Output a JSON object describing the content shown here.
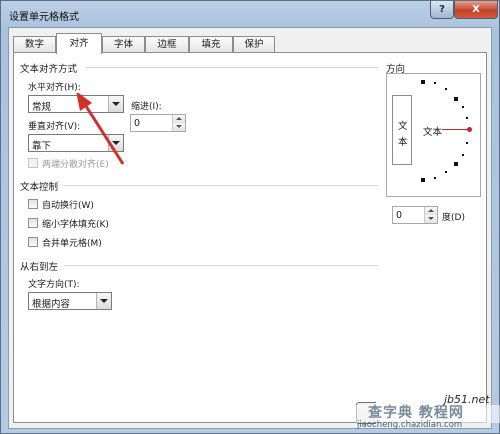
{
  "window": {
    "title": "设置单元格格式",
    "help_label": "?",
    "close_label": "X"
  },
  "tabs": [
    {
      "label": "数字",
      "active": false
    },
    {
      "label": "对齐",
      "active": true
    },
    {
      "label": "字体",
      "active": false
    },
    {
      "label": "边框",
      "active": false
    },
    {
      "label": "填充",
      "active": false
    },
    {
      "label": "保护",
      "active": false
    }
  ],
  "alignment": {
    "section_title": "文本对齐方式",
    "horizontal_label": "水平对齐(H):",
    "horizontal_value": "常规",
    "indent_label": "缩进(I):",
    "indent_value": "0",
    "vertical_label": "垂直对齐(V):",
    "vertical_value": "靠下",
    "distributed_label": "两端分散对齐(E)"
  },
  "text_control": {
    "section_title": "文本控制",
    "wrap_label": "自动换行(W)",
    "shrink_label": "缩小字体填充(K)",
    "merge_label": "合并单元格(M)"
  },
  "rtl": {
    "section_title": "从右到左",
    "direction_label": "文字方向(T):",
    "direction_value": "根据内容"
  },
  "orientation": {
    "section_title": "方向",
    "vertical_text_char1": "文",
    "vertical_text_char2": "本",
    "dial_text": "文本",
    "degree_value": "0",
    "degree_label": "度(D)"
  },
  "watermark": {
    "site_small": "jb51.net",
    "site_big": "查字典 教程网",
    "url": "jiaocheng.chazidian.com"
  },
  "colors": {
    "annotation_arrow": "#d0312d"
  }
}
